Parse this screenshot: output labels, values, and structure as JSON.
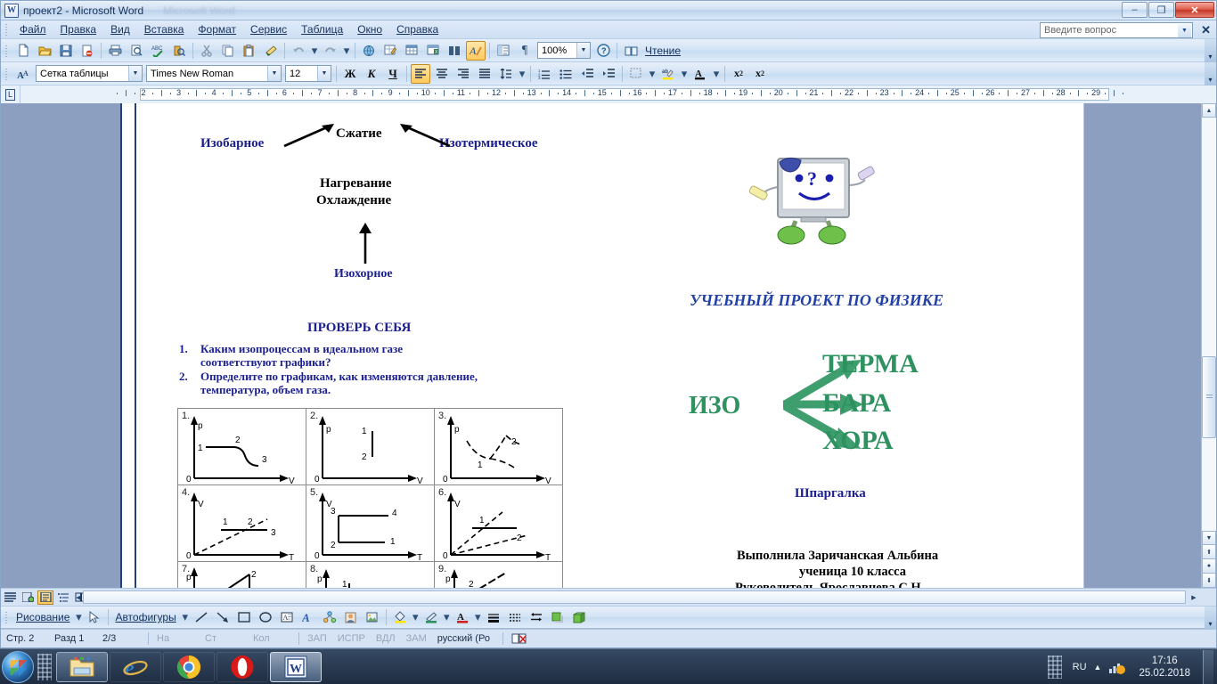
{
  "window": {
    "title": "проект2 - Microsoft Word",
    "ghost_title": "Microsoft Word",
    "icon": "word-document-icon",
    "minimize": "–",
    "maximize": "❐",
    "close": "✕"
  },
  "menubar": {
    "items": [
      {
        "label": "Файл",
        "name": "menu-file"
      },
      {
        "label": "Правка",
        "name": "menu-edit"
      },
      {
        "label": "Вид",
        "name": "menu-view"
      },
      {
        "label": "Вставка",
        "name": "menu-insert"
      },
      {
        "label": "Формат",
        "name": "menu-format"
      },
      {
        "label": "Сервис",
        "name": "menu-tools"
      },
      {
        "label": "Таблица",
        "name": "menu-table"
      },
      {
        "label": "Окно",
        "name": "menu-window"
      },
      {
        "label": "Справка",
        "name": "menu-help"
      }
    ],
    "ask_placeholder": "Введите вопрос",
    "close_label": "✕"
  },
  "standard_toolbar": {
    "zoom_value": "100%",
    "reading_label": "Чтение",
    "buttons": [
      "new-document-icon",
      "open-folder-icon",
      "save-disk-icon",
      "permission-icon",
      "print-icon",
      "print-preview-icon",
      "spellcheck-icon",
      "research-icon",
      "cut-scissors-icon",
      "copy-icon",
      "paste-icon",
      "format-painter-icon",
      "undo-icon",
      "redo-icon",
      "insert-hyperlink-icon",
      "tables-borders-icon",
      "insert-table-icon",
      "insert-excel-table-icon",
      "columns-icon",
      "drawing-icon",
      "document-map-icon",
      "show-formatting-icon",
      "help-icon"
    ]
  },
  "formatting_toolbar": {
    "style_value": "Сетка таблицы",
    "font_value": "Times New Roman",
    "size_value": "12",
    "bold_label": "Ж",
    "italic_label": "К",
    "underline_label": "Ч",
    "buttons": [
      "align-left-icon",
      "align-center-icon",
      "align-right-icon",
      "justify-icon",
      "line-spacing-icon",
      "numbered-list-icon",
      "bulleted-list-icon",
      "decrease-indent-icon",
      "increase-indent-icon",
      "borders-icon",
      "highlight-color-icon",
      "font-color-icon",
      "superscript-icon",
      "subscript-icon"
    ]
  },
  "ruler": {
    "tab_marker": "L",
    "numbers": [
      "2",
      "3",
      "4",
      "5",
      "6",
      "7",
      "8",
      "9",
      "10",
      "11",
      "12",
      "13",
      "14",
      "15",
      "16",
      "17",
      "18",
      "19",
      "20",
      "21",
      "22",
      "23",
      "24",
      "25",
      "26",
      "27",
      "28",
      "29"
    ]
  },
  "document": {
    "top_diagram": {
      "left_label": "Изобарное",
      "center_label": "Сжатие",
      "right_label": "Изотермическое",
      "mid_line1": "Нагревание",
      "mid_line2": "Охлаждение",
      "bottom_label": "Изохорное"
    },
    "check_yourself": {
      "heading": "ПРОВЕРЬ СЕБЯ",
      "items": [
        {
          "num": "1.",
          "line1": "Каким изопроцессам в идеальном газе",
          "line2": "соответствуют графики?"
        },
        {
          "num": "2.",
          "line1": "Определите по графикам, как изменяются давление,",
          "line2": "температура, объем газа."
        }
      ]
    },
    "graph_table": {
      "cells": [
        {
          "num": "1.",
          "yaxis": "p",
          "xaxis": "V",
          "origin": "0",
          "points": [
            "1",
            "2",
            "3"
          ]
        },
        {
          "num": "2.",
          "yaxis": "p",
          "xaxis": "V",
          "origin": "0",
          "points": [
            "1",
            "2"
          ]
        },
        {
          "num": "3.",
          "yaxis": "p",
          "xaxis": "V",
          "origin": "0",
          "points": [
            "1",
            "2"
          ]
        },
        {
          "num": "4.",
          "yaxis": "V",
          "xaxis": "T",
          "origin": "0",
          "points": [
            "1",
            "2",
            "3"
          ]
        },
        {
          "num": "5.",
          "yaxis": "V",
          "xaxis": "T",
          "origin": "0",
          "points": [
            "3",
            "4",
            "2",
            "1"
          ]
        },
        {
          "num": "6.",
          "yaxis": "V",
          "xaxis": "T",
          "origin": "0",
          "points": [
            "1",
            "2"
          ]
        },
        {
          "num": "7.",
          "yaxis": "p",
          "xaxis": "",
          "origin": "",
          "points": [
            "2"
          ]
        },
        {
          "num": "8.",
          "yaxis": "p",
          "xaxis": "",
          "origin": "",
          "points": [
            "1"
          ]
        },
        {
          "num": "9.",
          "yaxis": "p",
          "xaxis": "",
          "origin": "",
          "points": [
            "2"
          ]
        }
      ]
    },
    "right_panel": {
      "robot_image": "computer-robot-question-clipart",
      "project_title": "УЧЕБНЫЙ ПРОЕКТ ПО ФИЗИКЕ",
      "iso_root": "ИЗО",
      "iso_branches": [
        "ТЕРМА",
        "БАРА",
        "ХОРА"
      ],
      "cheatsheet": "Шпаргалка",
      "author_line1": "Выполнила  Заричанская Альбина",
      "author_line2": "ученица 10 класса",
      "author_line3": "Руководитель Ярославцева С.Н."
    }
  },
  "drawing_toolbar": {
    "draw_label": "Рисование",
    "autoshapes_label": "Автофигуры",
    "buttons": [
      "select-arrow-icon",
      "line-icon",
      "arrow-icon",
      "rectangle-icon",
      "oval-icon",
      "text-box-icon",
      "wordart-icon",
      "diagram-icon",
      "clipart-icon",
      "picture-icon",
      "fill-color-icon",
      "line-color-icon",
      "font-color-icon",
      "line-style-icon",
      "dash-style-icon",
      "arrow-style-icon",
      "shadow-style-icon",
      "3d-style-icon"
    ]
  },
  "view_buttons": [
    "normal-view-icon",
    "web-layout-icon",
    "print-layout-icon",
    "outline-view-icon",
    "reading-layout-icon"
  ],
  "statusbar": {
    "page": "Стр. 2",
    "section": "Разд 1",
    "pages": "2/3",
    "at": "На",
    "line": "Ст",
    "col": "Кол",
    "rec": "ЗАП",
    "trk": "ИСПР",
    "ext": "ВДЛ",
    "ovr": "ЗАМ",
    "language": "русский (Ро",
    "spell_icon": "spelling-status-icon"
  },
  "taskbar": {
    "start": "start-orb-icon",
    "items": [
      {
        "name": "taskbar-explorer",
        "icon": "folder-icon",
        "state": "open"
      },
      {
        "name": "taskbar-internet-explorer",
        "icon": "internet-explorer-icon",
        "state": "idle"
      },
      {
        "name": "taskbar-chrome",
        "icon": "chrome-icon",
        "state": "idle"
      },
      {
        "name": "taskbar-opera",
        "icon": "opera-icon",
        "state": "idle"
      },
      {
        "name": "taskbar-word",
        "icon": "word-icon",
        "state": "active"
      }
    ],
    "language": "RU",
    "time": "17:16",
    "date": "25.02.2018"
  },
  "colors": {
    "title_blue": "#1b1f8f",
    "project_blue": "#2342a8",
    "iso_green": "#2e9160",
    "taskbar": "#1a283c"
  }
}
